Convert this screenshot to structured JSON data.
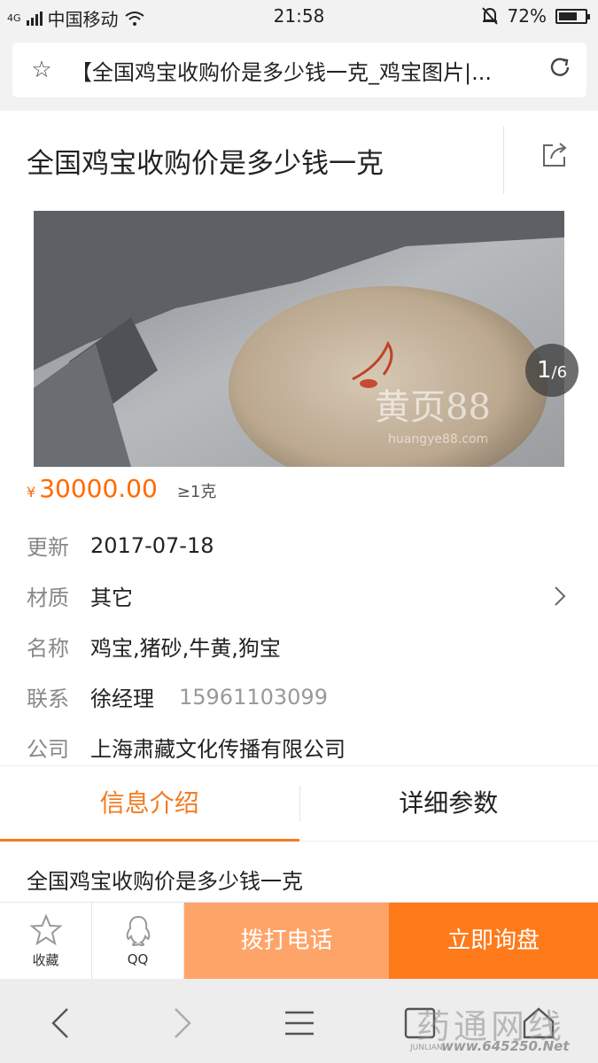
{
  "status_bar": {
    "network": "4G",
    "carrier": "中国移动",
    "time": "21:58",
    "battery": "72%",
    "battery_level": 0.72
  },
  "browser": {
    "url_text": "【全国鸡宝收购价是多少钱一克_鸡宝图片|...",
    "star_icon": "star-outline-icon",
    "reload_icon": "reload-icon"
  },
  "product": {
    "title": "全国鸡宝收购价是多少钱一克",
    "image_counter_current": "1",
    "image_counter_total": "/6",
    "image_watermark": "黄页88",
    "image_watermark_url": "huangye88.com",
    "price_symbol": "¥",
    "price": "30000.00",
    "min_order": "≥1克",
    "info": [
      {
        "label": "更新",
        "value": "2017-07-18",
        "extra": ""
      },
      {
        "label": "材质",
        "value": "其它",
        "extra": ""
      },
      {
        "label": "名称",
        "value": "鸡宝,猪砂,牛黄,狗宝",
        "extra": ""
      },
      {
        "label": "联系",
        "value": "徐经理",
        "extra": "15961103099"
      },
      {
        "label": "公司",
        "value": "上海肃藏文化传播有限公司",
        "extra": ""
      }
    ]
  },
  "tabs": [
    {
      "label": "信息介绍",
      "active": true
    },
    {
      "label": "详细参数",
      "active": false
    }
  ],
  "intro_text": "全国鸡宝收购价是多少钱一克",
  "action_bar": {
    "favorite_label": "收藏",
    "qq_label": "QQ",
    "call_label": "拨打电话",
    "inquire_label": "立即询盘"
  },
  "watermark": {
    "text": "药通网线",
    "brand": "JUNLIAN",
    "url": "www.645250.Net"
  },
  "colors": {
    "accent": "#f47b20",
    "price": "#ff6a00",
    "call_button": "#ffa468",
    "inquire_button": "#ff7a1a"
  }
}
